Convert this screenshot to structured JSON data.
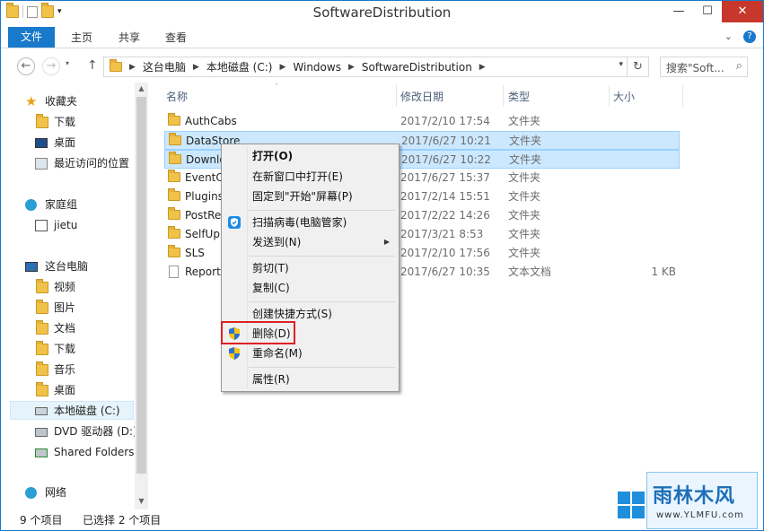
{
  "window": {
    "title": "SoftwareDistribution",
    "controls": {
      "minimize": "—",
      "maximize": "☐",
      "close": "✕"
    }
  },
  "ribbon": {
    "tabs": [
      "文件",
      "主页",
      "共享",
      "查看"
    ],
    "right": {
      "expand": "⌄",
      "help": "?"
    }
  },
  "address_bar": {
    "back": "←",
    "forward": "→",
    "up": "↑",
    "segments": [
      "这台电脑",
      "本地磁盘 (C:)",
      "Windows",
      "SoftwareDistribution"
    ],
    "search_placeholder": "搜索\"Soft...",
    "search_icon": "⌕",
    "refresh_icon": "↻"
  },
  "nav_pane": {
    "items": [
      {
        "label": "收藏夹",
        "icon": "star-icon"
      },
      {
        "label": "下载",
        "icon": "downloads-folder-icon"
      },
      {
        "label": "桌面",
        "icon": "desktop-icon"
      },
      {
        "label": "最近访问的位置",
        "icon": "recent-places-icon"
      },
      {
        "label": "家庭组",
        "icon": "homegroup-icon"
      },
      {
        "label": "jietu",
        "icon": "user-icon"
      },
      {
        "label": "这台电脑",
        "icon": "computer-icon"
      },
      {
        "label": "视频",
        "icon": "videos-folder-icon"
      },
      {
        "label": "图片",
        "icon": "pictures-folder-icon"
      },
      {
        "label": "文档",
        "icon": "documents-folder-icon"
      },
      {
        "label": "下载",
        "icon": "downloads-folder-icon"
      },
      {
        "label": "音乐",
        "icon": "music-folder-icon"
      },
      {
        "label": "桌面",
        "icon": "desktop-folder-icon"
      },
      {
        "label": "本地磁盘 (C:)",
        "icon": "local-disk-icon"
      },
      {
        "label": "DVD 驱动器 (D:)",
        "icon": "dvd-drive-icon"
      },
      {
        "label": "Shared Folders",
        "icon": "network-drive-icon"
      },
      {
        "label": "网络",
        "icon": "network-icon"
      }
    ]
  },
  "file_list": {
    "columns": [
      "名称",
      "修改日期",
      "类型",
      "大小"
    ],
    "rows": [
      {
        "name": "AuthCabs",
        "date": "2017/2/10 17:54",
        "type": "文件夹",
        "size": ""
      },
      {
        "name": "DataStore",
        "date": "2017/6/27 10:21",
        "type": "文件夹",
        "size": ""
      },
      {
        "name": "Downlo",
        "date": "2017/6/27 10:22",
        "type": "文件夹",
        "size": ""
      },
      {
        "name": "EventC",
        "date": "2017/6/27 15:37",
        "type": "文件夹",
        "size": ""
      },
      {
        "name": "Plugins",
        "date": "2017/2/14 15:51",
        "type": "文件夹",
        "size": ""
      },
      {
        "name": "PostRe",
        "date": "2017/2/22 14:26",
        "type": "文件夹",
        "size": ""
      },
      {
        "name": "SelfUp",
        "date": "2017/3/21 8:53",
        "type": "文件夹",
        "size": ""
      },
      {
        "name": "SLS",
        "date": "2017/2/10 17:56",
        "type": "文件夹",
        "size": ""
      },
      {
        "name": "Report",
        "date": "2017/6/27 10:35",
        "type": "文本文档",
        "size": "1 KB"
      }
    ]
  },
  "context_menu": {
    "items": [
      {
        "label": "打开(O)"
      },
      {
        "label": "在新窗口中打开(E)"
      },
      {
        "label": "固定到\"开始\"屏幕(P)"
      },
      {
        "label": "扫描病毒(电脑管家)"
      },
      {
        "label": "发送到(N)"
      },
      {
        "label": "剪切(T)"
      },
      {
        "label": "复制(C)"
      },
      {
        "label": "创建快捷方式(S)"
      },
      {
        "label": "删除(D)"
      },
      {
        "label": "重命名(M)"
      },
      {
        "label": "属性(R)"
      }
    ],
    "submenu_arrow": "▶"
  },
  "status_bar": {
    "count": "9 个项目",
    "selection": "已选择 2 个项目"
  },
  "watermark": {
    "brand": "雨林木风",
    "url": "www.YLMFU.com"
  },
  "colors": {
    "accent": "#1979ca",
    "selection": "#cce8ff",
    "highlight_box": "#e02020",
    "folder": "#f1c24a"
  }
}
